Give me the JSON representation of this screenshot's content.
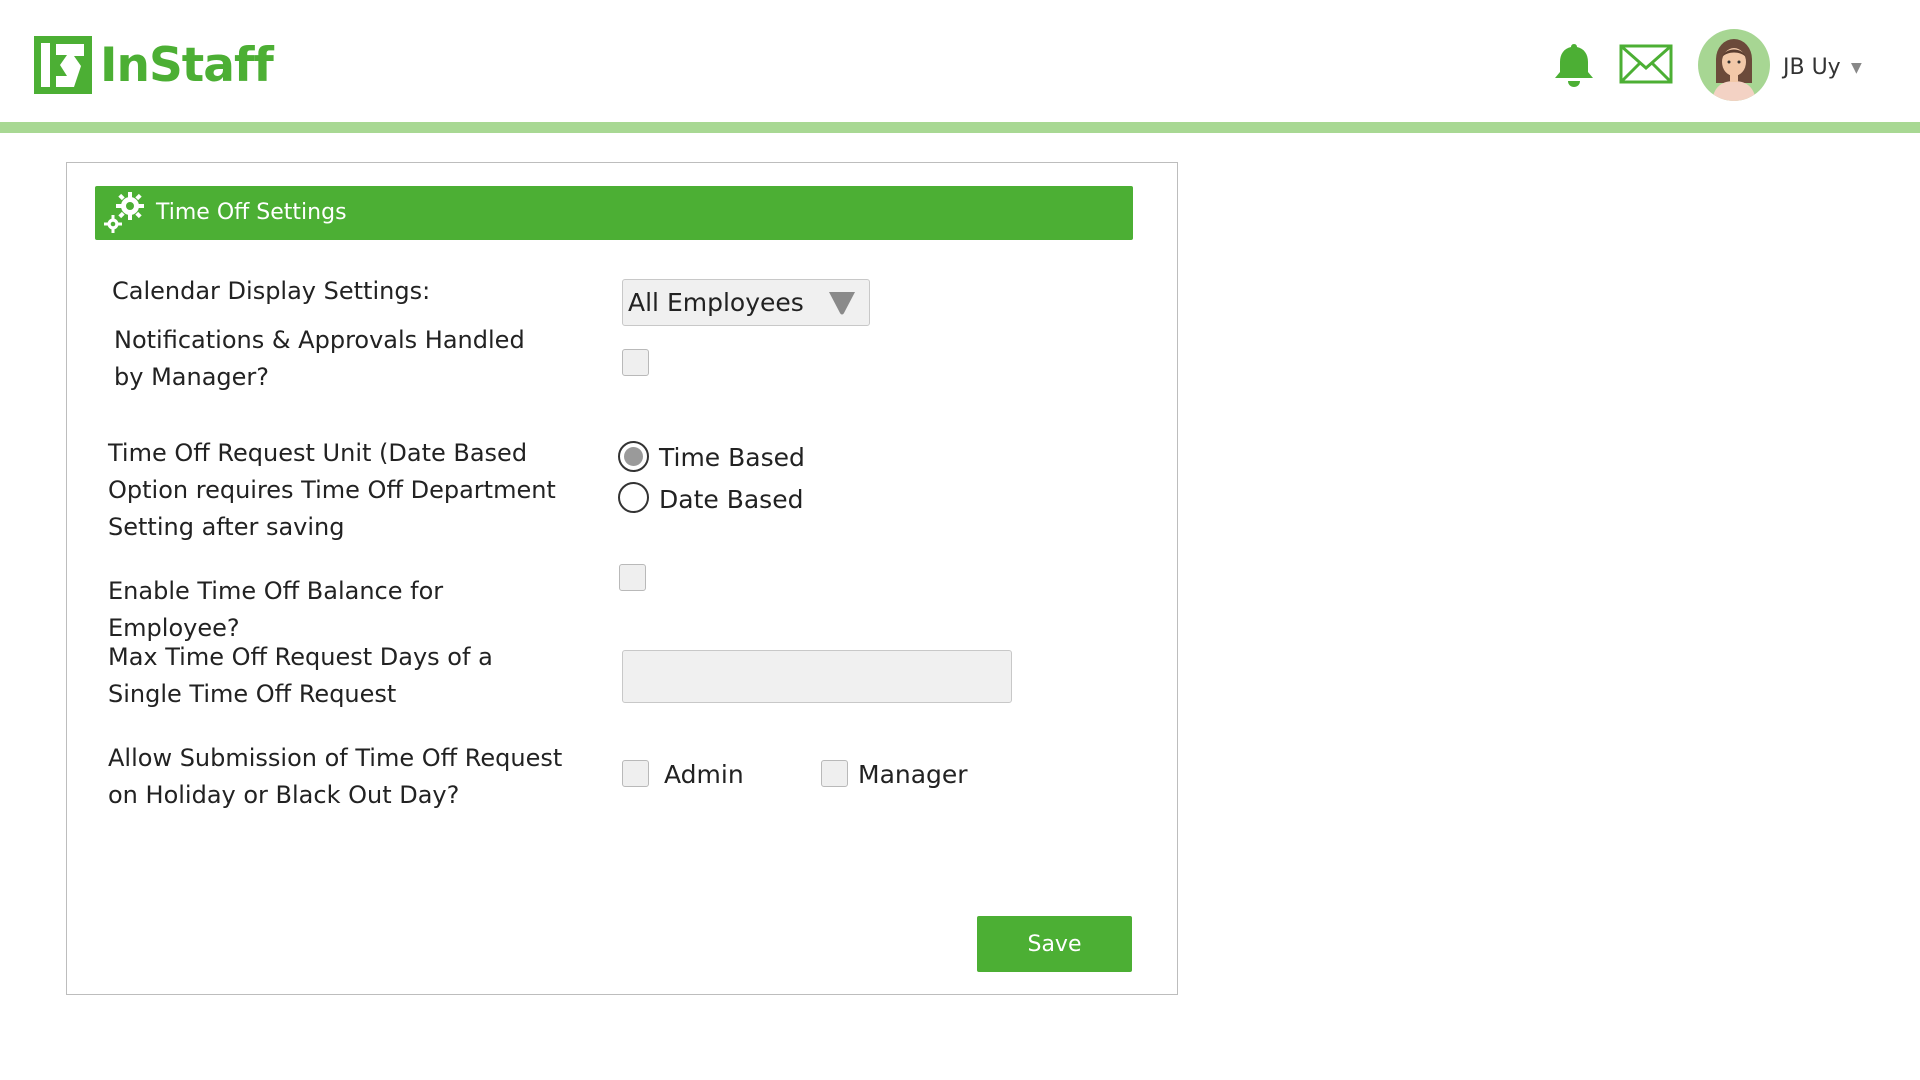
{
  "app": {
    "name": "InStaff"
  },
  "header": {
    "user_name": "JB Uy",
    "icons": [
      "bell-icon",
      "mail-icon",
      "avatar",
      "chevron-down-icon"
    ]
  },
  "colors": {
    "brand_green": "#4caf34",
    "accent_bar": "#a8d893",
    "avatar_bg": "#a7d693"
  },
  "panel": {
    "title": "Time Off Settings",
    "calendar_display": {
      "label": "Calendar Display Settings:",
      "selected": "All Employees"
    },
    "notifications": {
      "label_line1": "Notifications & Approvals Handled",
      "label_line2": "by Manager?",
      "checked": false
    },
    "request_unit": {
      "label_line1": "Time Off Request Unit (Date Based",
      "label_line2": "Option requires Time Off Department",
      "label_line3": "Setting after saving",
      "options": [
        "Time Based",
        "Date Based"
      ],
      "selected": "Time Based"
    },
    "enable_balance": {
      "label_line1": "Enable Time Off Balance for",
      "label_line2": "Employee?",
      "checked": false
    },
    "max_days": {
      "label_line1": "Max Time Off Request Days of a",
      "label_line2": "Single Time Off Request",
      "value": ""
    },
    "allow_submission": {
      "label_line1": "Allow Submission of Time Off Request",
      "label_line2": "on Holiday or Black Out Day?",
      "options": [
        "Admin",
        "Manager"
      ]
    },
    "save_label": "Save"
  }
}
